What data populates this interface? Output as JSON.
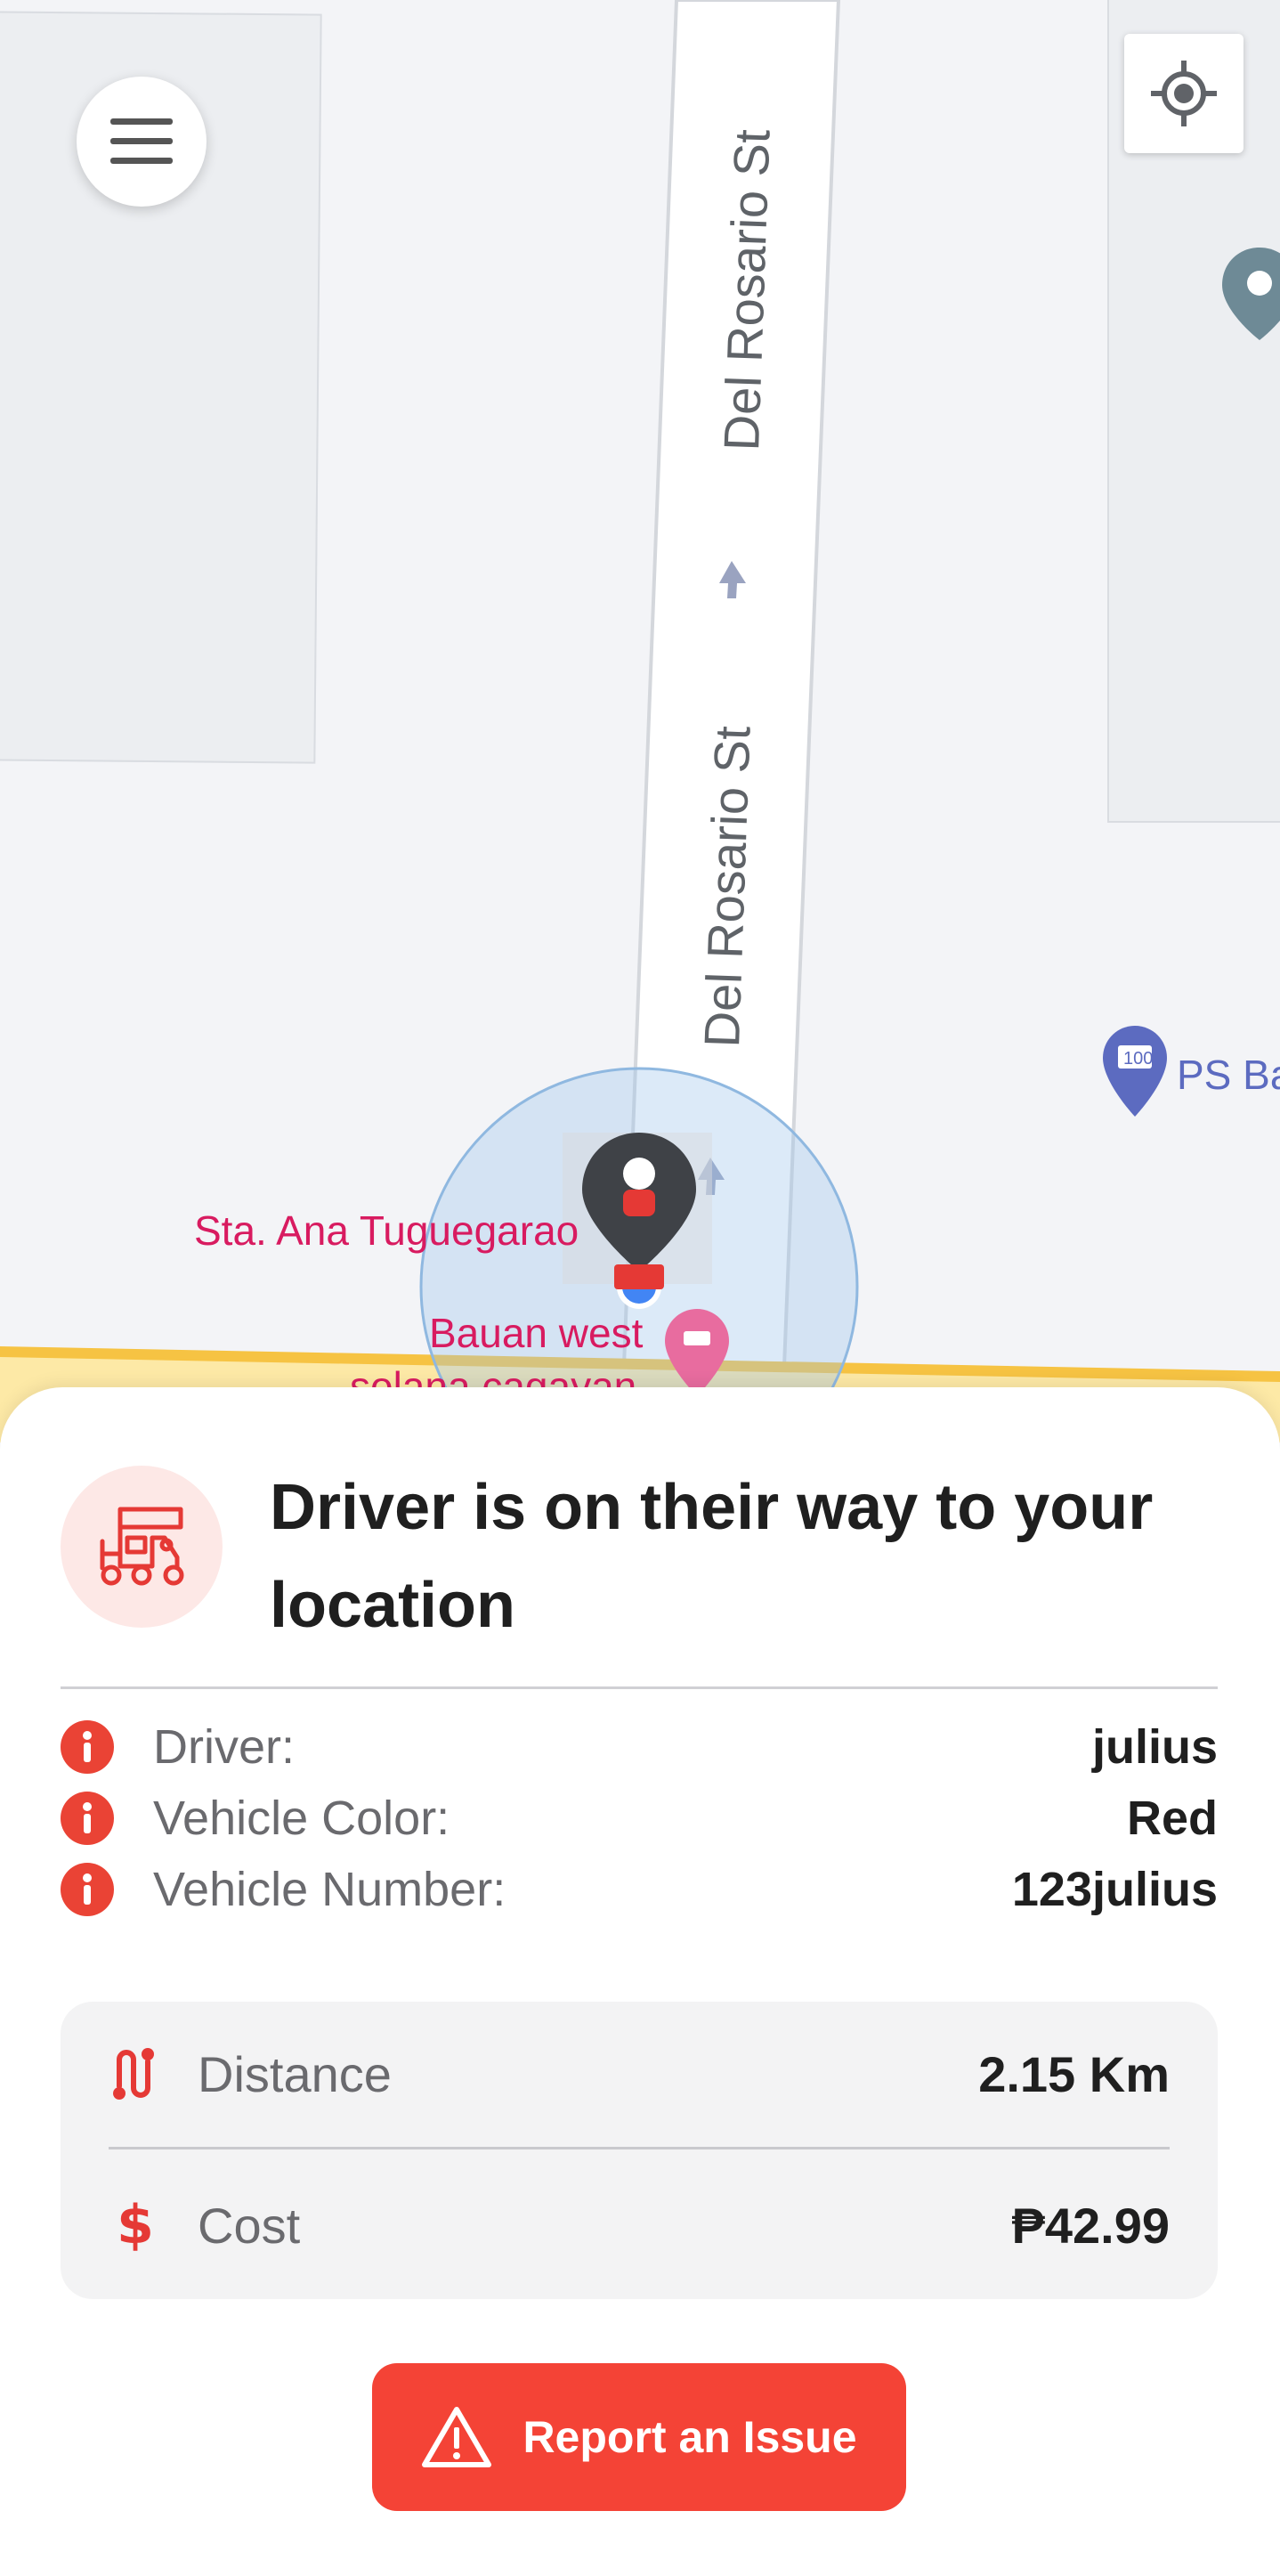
{
  "map": {
    "streets": [
      "Del Rosario St",
      "Del Rosario St"
    ],
    "places": {
      "sta_ana": "Sta. Ana Tuguegarao",
      "bauan_line1": "Bauan west",
      "bauan_line2": "solana cagayan",
      "ps_bank": "PS Ba",
      "atm_badge": "100"
    },
    "colors": {
      "pink_poi": "#d81b60",
      "blue_poi": "#5c6bc0",
      "user_dot": "#4285f4"
    }
  },
  "controls": {
    "menu_icon": "hamburger-menu-icon",
    "locate_icon": "my-location-icon"
  },
  "sheet": {
    "title": "Driver is on their way to your location",
    "details": [
      {
        "label": "Driver:",
        "value": "julius"
      },
      {
        "label": "Vehicle Color:",
        "value": "Red"
      },
      {
        "label": "Vehicle Number:",
        "value": "123julius"
      }
    ],
    "trip": {
      "distance_label": "Distance",
      "distance_value": "2.15 Km",
      "cost_label": "Cost",
      "cost_value": "₱42.99"
    },
    "report_label": "Report an Issue",
    "accent": "#f44336"
  }
}
